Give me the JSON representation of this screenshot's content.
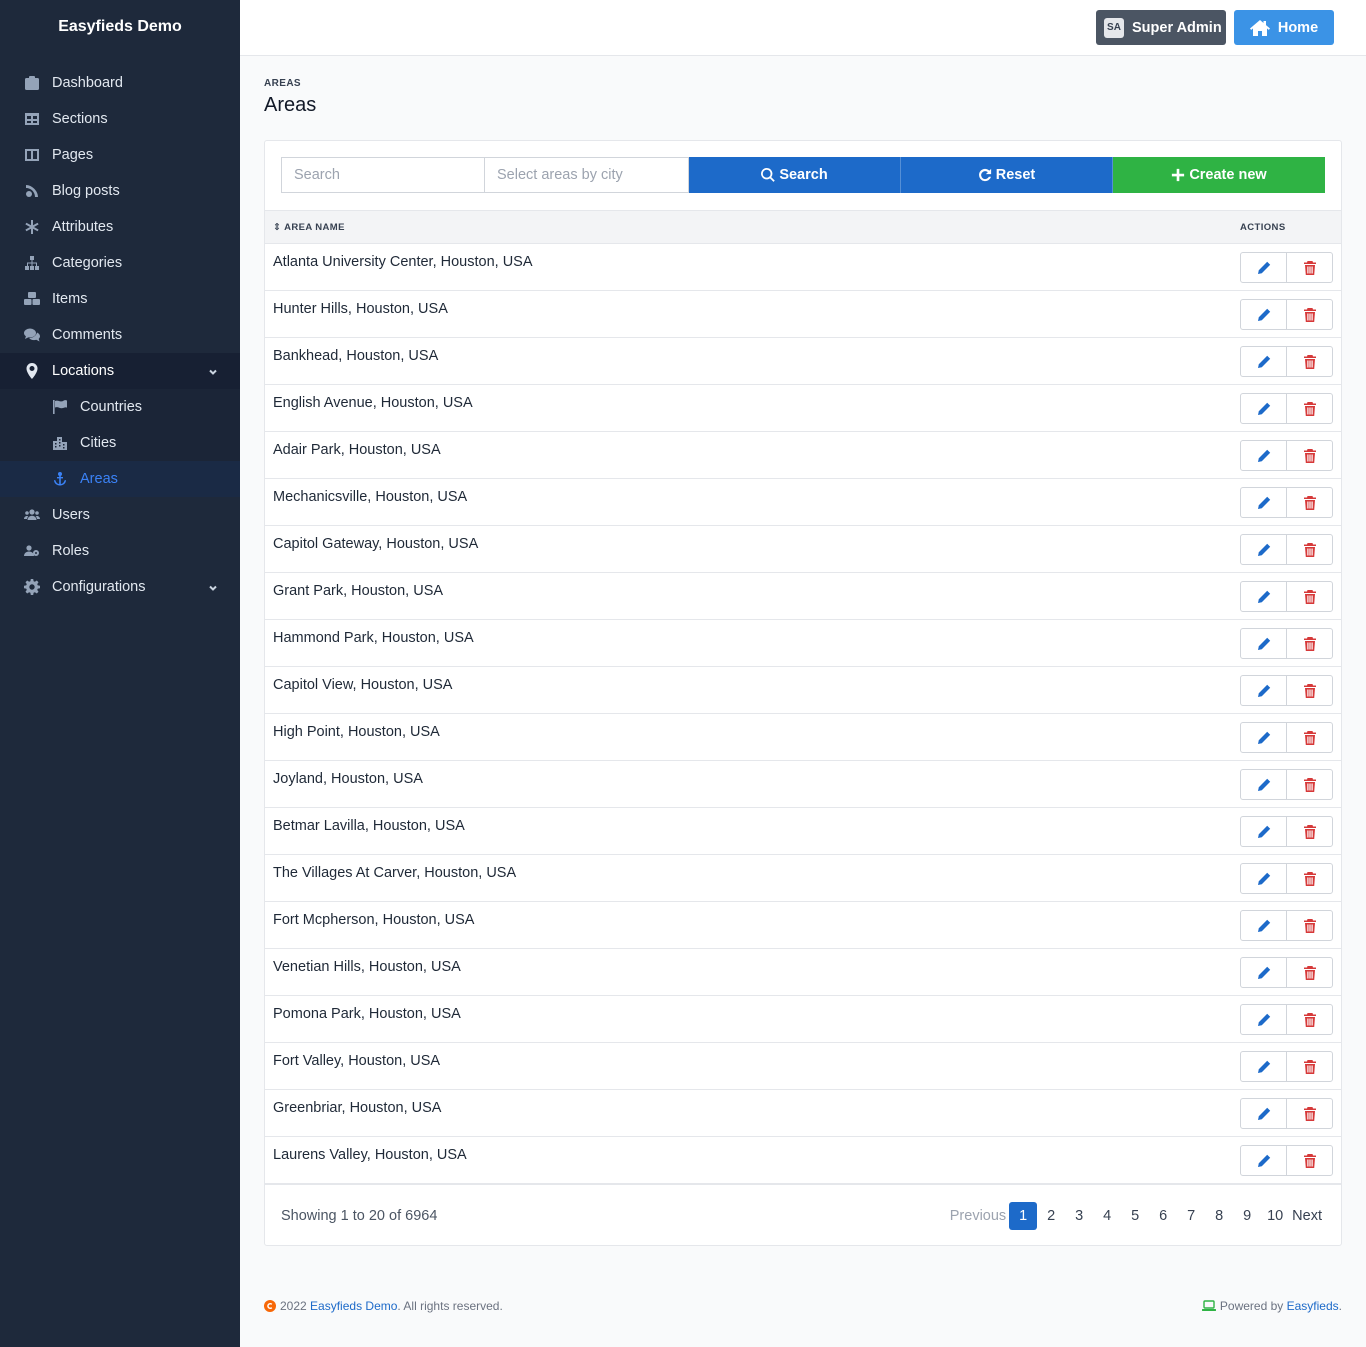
{
  "app": {
    "brand": "Easyfieds Demo"
  },
  "sidebar": {
    "items": [
      {
        "label": "Dashboard",
        "icon": "dashboard-icon"
      },
      {
        "label": "Sections",
        "icon": "sections-icon"
      },
      {
        "label": "Pages",
        "icon": "pages-icon"
      },
      {
        "label": "Blog posts",
        "icon": "blog-icon"
      },
      {
        "label": "Attributes",
        "icon": "asterisk-icon"
      },
      {
        "label": "Categories",
        "icon": "sitemap-icon"
      },
      {
        "label": "Items",
        "icon": "boxes-icon"
      },
      {
        "label": "Comments",
        "icon": "comments-icon"
      },
      {
        "label": "Locations",
        "icon": "map-marker-icon"
      },
      {
        "label": "Users",
        "icon": "users-icon"
      },
      {
        "label": "Roles",
        "icon": "roles-icon"
      },
      {
        "label": "Configurations",
        "icon": "cog-icon"
      }
    ],
    "locations_sub": [
      {
        "label": "Countries",
        "icon": "flag-icon"
      },
      {
        "label": "Cities",
        "icon": "city-icon"
      },
      {
        "label": "Areas",
        "icon": "anchor-icon"
      }
    ]
  },
  "topbar": {
    "admin_initials": "SA",
    "admin_label": "Super Admin",
    "home_label": "Home"
  },
  "page": {
    "breadcrumb": "AREAS",
    "title": "Areas"
  },
  "toolbar": {
    "search_placeholder": "Search",
    "city_placeholder": "Select areas by city",
    "search_label": "Search",
    "reset_label": "Reset",
    "create_label": "Create new"
  },
  "table": {
    "col_name": "AREA NAME",
    "col_actions": "ACTIONS",
    "rows": [
      "Atlanta University Center, Houston, USA",
      "Hunter Hills, Houston, USA",
      "Bankhead, Houston, USA",
      "English Avenue, Houston, USA",
      "Adair Park, Houston, USA",
      "Mechanicsville, Houston, USA",
      "Capitol Gateway, Houston, USA",
      "Grant Park, Houston, USA",
      "Hammond Park, Houston, USA",
      "Capitol View, Houston, USA",
      "High Point, Houston, USA",
      "Joyland, Houston, USA",
      "Betmar Lavilla, Houston, USA",
      "The Villages At Carver, Houston, USA",
      "Fort Mcpherson, Houston, USA",
      "Venetian Hills, Houston, USA",
      "Pomona Park, Houston, USA",
      "Fort Valley, Houston, USA",
      "Greenbriar, Houston, USA",
      "Laurens Valley, Houston, USA"
    ]
  },
  "pagination": {
    "showing": "Showing 1 to 20 of 6964",
    "previous": "Previous",
    "next": "Next",
    "pages": [
      "1",
      "2",
      "3",
      "4",
      "5",
      "6",
      "7",
      "8",
      "9",
      "10"
    ],
    "current": "1"
  },
  "footer": {
    "year": "2022",
    "brand_link": "Easyfieds Demo",
    "rights": ". All rights reserved.",
    "powered": "Powered by",
    "powered_link": "Easyfieds",
    "powered_end": "."
  },
  "colors": {
    "sidebar_bg": "#1e293b",
    "primary": "#1d6ac9",
    "success": "#2fb344",
    "danger": "#d63939",
    "home_button": "#3b93e6"
  }
}
